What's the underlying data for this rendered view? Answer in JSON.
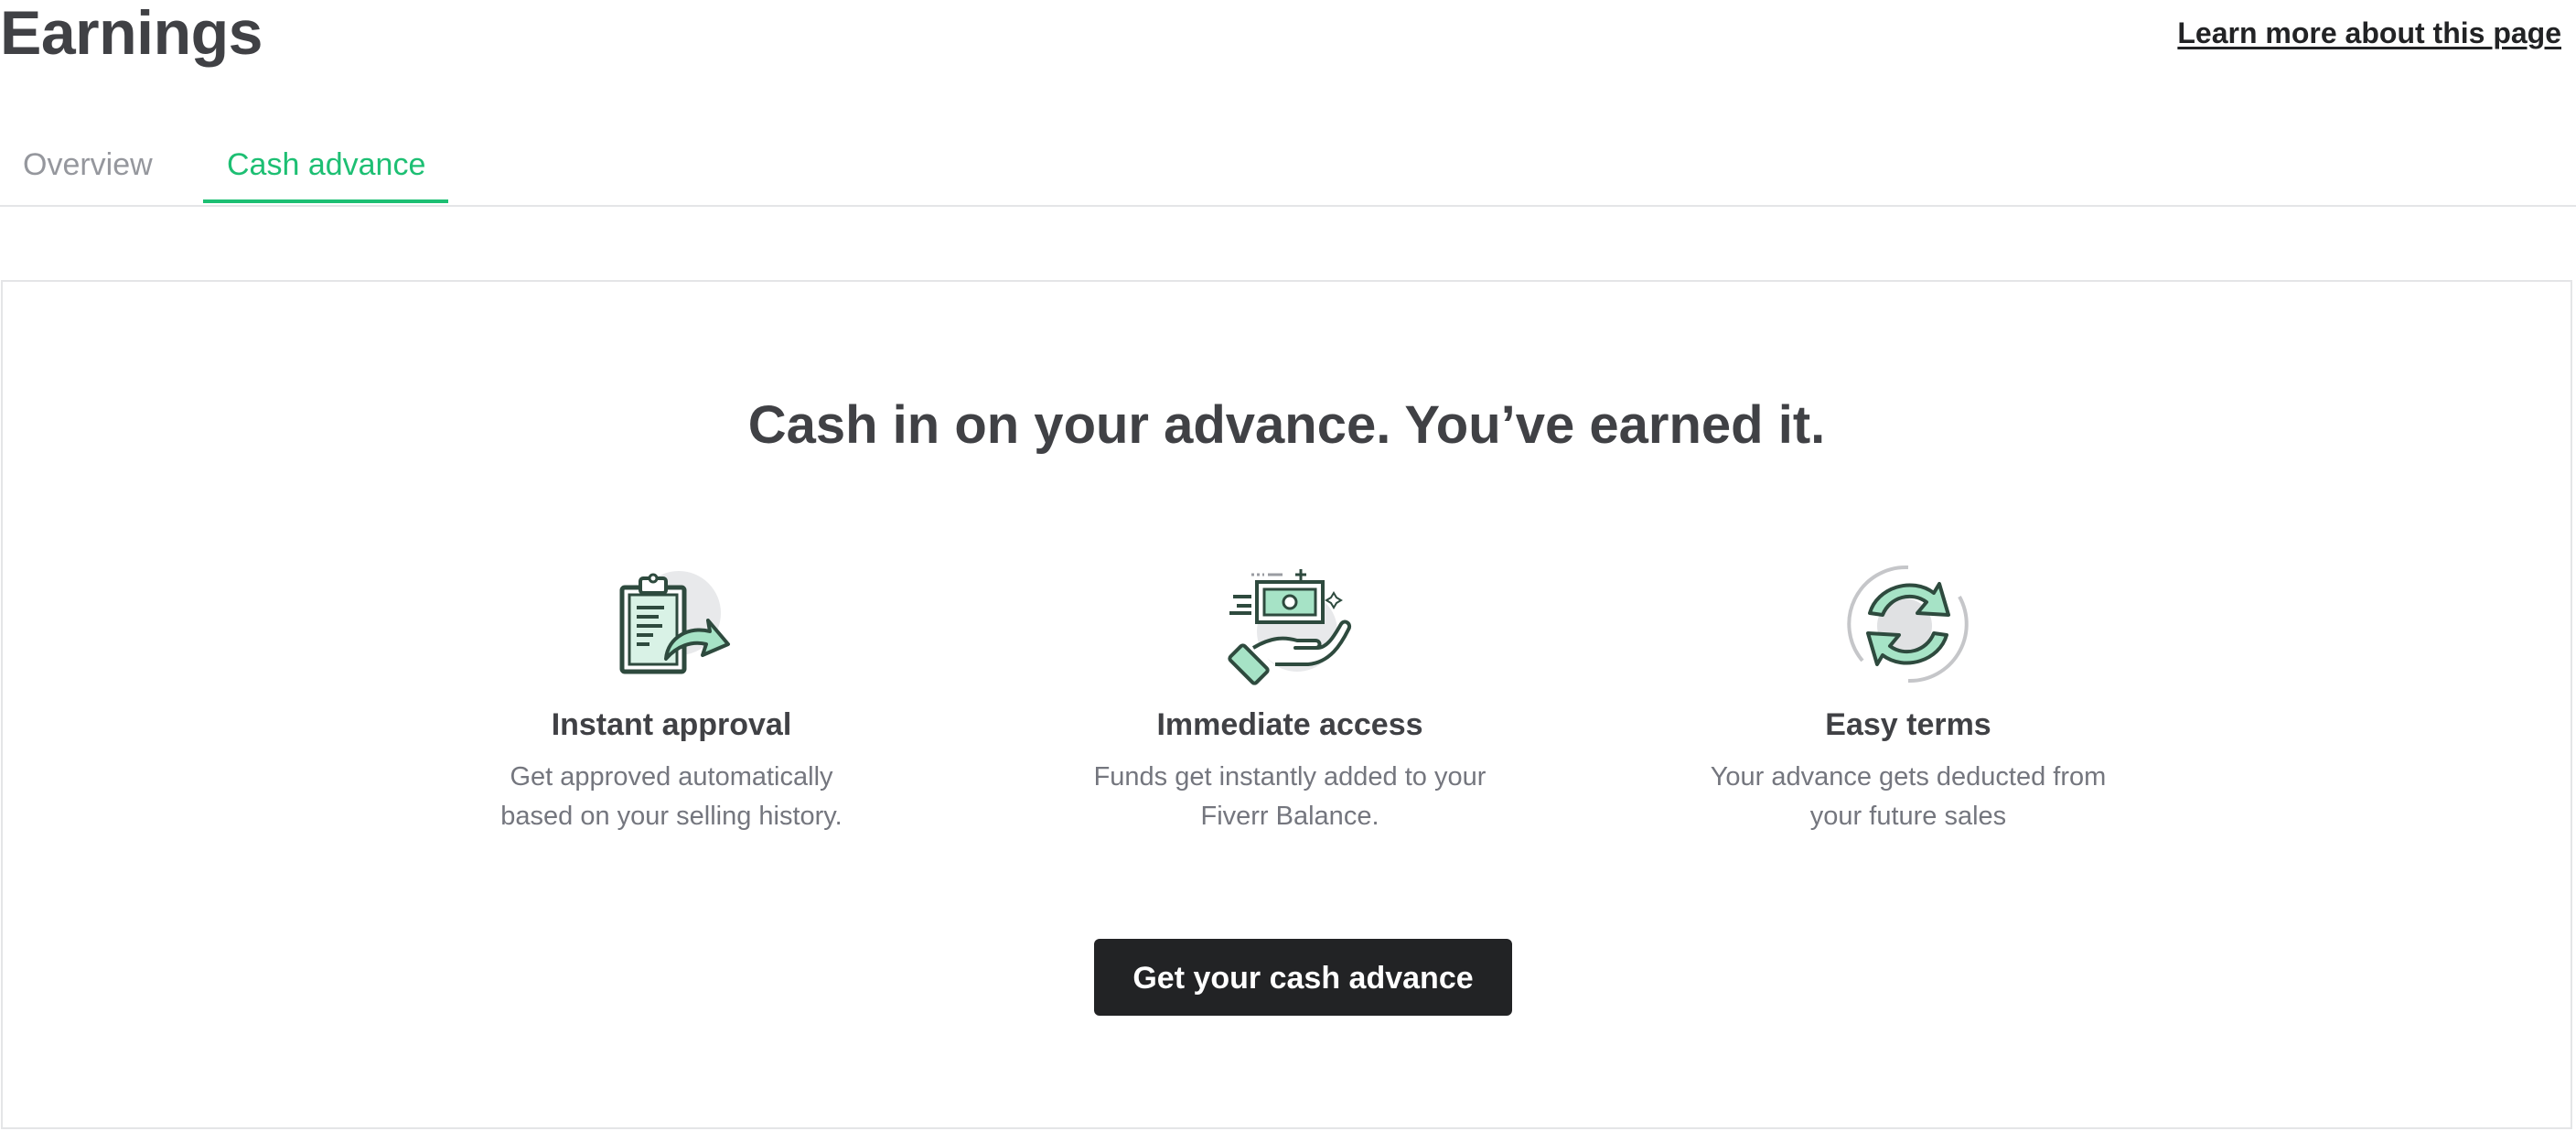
{
  "header": {
    "title": "Earnings",
    "learn_more": "Learn more about this page"
  },
  "tabs": [
    {
      "label": "Overview",
      "active": false
    },
    {
      "label": "Cash advance",
      "active": true
    }
  ],
  "panel": {
    "headline": "Cash in on your advance. You’ve earned it.",
    "features": [
      {
        "icon": "clipboard-arrow-icon",
        "title": "Instant approval",
        "description": "Get approved automatically\nbased on your selling history."
      },
      {
        "icon": "hand-cash-icon",
        "title": "Immediate access",
        "description": "Funds get instantly added to your\nFiverr Balance."
      },
      {
        "icon": "refresh-cycle-icon",
        "title": "Easy terms",
        "description": "Your advance gets deducted from\nyour future sales"
      }
    ],
    "cta_label": "Get your cash advance"
  },
  "colors": {
    "accent": "#1dbf73",
    "icon_mint": "#a6e3c6",
    "icon_stroke": "#2e4a3e",
    "text_dark": "#404145",
    "text_muted": "#74767e",
    "button_bg": "#222325"
  }
}
